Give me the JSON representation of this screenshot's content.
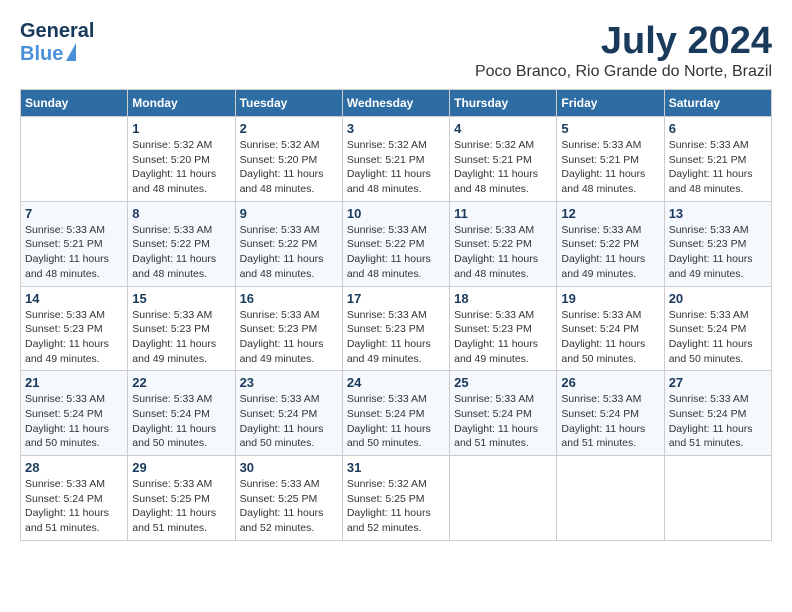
{
  "header": {
    "logo_general": "General",
    "logo_blue": "Blue",
    "month": "July 2024",
    "location": "Poco Branco, Rio Grande do Norte, Brazil"
  },
  "columns": [
    "Sunday",
    "Monday",
    "Tuesday",
    "Wednesday",
    "Thursday",
    "Friday",
    "Saturday"
  ],
  "weeks": [
    [
      {
        "day": "",
        "info": ""
      },
      {
        "day": "1",
        "info": "Sunrise: 5:32 AM\nSunset: 5:20 PM\nDaylight: 11 hours\nand 48 minutes."
      },
      {
        "day": "2",
        "info": "Sunrise: 5:32 AM\nSunset: 5:20 PM\nDaylight: 11 hours\nand 48 minutes."
      },
      {
        "day": "3",
        "info": "Sunrise: 5:32 AM\nSunset: 5:21 PM\nDaylight: 11 hours\nand 48 minutes."
      },
      {
        "day": "4",
        "info": "Sunrise: 5:32 AM\nSunset: 5:21 PM\nDaylight: 11 hours\nand 48 minutes."
      },
      {
        "day": "5",
        "info": "Sunrise: 5:33 AM\nSunset: 5:21 PM\nDaylight: 11 hours\nand 48 minutes."
      },
      {
        "day": "6",
        "info": "Sunrise: 5:33 AM\nSunset: 5:21 PM\nDaylight: 11 hours\nand 48 minutes."
      }
    ],
    [
      {
        "day": "7",
        "info": "Sunrise: 5:33 AM\nSunset: 5:21 PM\nDaylight: 11 hours\nand 48 minutes."
      },
      {
        "day": "8",
        "info": "Sunrise: 5:33 AM\nSunset: 5:22 PM\nDaylight: 11 hours\nand 48 minutes."
      },
      {
        "day": "9",
        "info": "Sunrise: 5:33 AM\nSunset: 5:22 PM\nDaylight: 11 hours\nand 48 minutes."
      },
      {
        "day": "10",
        "info": "Sunrise: 5:33 AM\nSunset: 5:22 PM\nDaylight: 11 hours\nand 48 minutes."
      },
      {
        "day": "11",
        "info": "Sunrise: 5:33 AM\nSunset: 5:22 PM\nDaylight: 11 hours\nand 48 minutes."
      },
      {
        "day": "12",
        "info": "Sunrise: 5:33 AM\nSunset: 5:22 PM\nDaylight: 11 hours\nand 49 minutes."
      },
      {
        "day": "13",
        "info": "Sunrise: 5:33 AM\nSunset: 5:23 PM\nDaylight: 11 hours\nand 49 minutes."
      }
    ],
    [
      {
        "day": "14",
        "info": "Sunrise: 5:33 AM\nSunset: 5:23 PM\nDaylight: 11 hours\nand 49 minutes."
      },
      {
        "day": "15",
        "info": "Sunrise: 5:33 AM\nSunset: 5:23 PM\nDaylight: 11 hours\nand 49 minutes."
      },
      {
        "day": "16",
        "info": "Sunrise: 5:33 AM\nSunset: 5:23 PM\nDaylight: 11 hours\nand 49 minutes."
      },
      {
        "day": "17",
        "info": "Sunrise: 5:33 AM\nSunset: 5:23 PM\nDaylight: 11 hours\nand 49 minutes."
      },
      {
        "day": "18",
        "info": "Sunrise: 5:33 AM\nSunset: 5:23 PM\nDaylight: 11 hours\nand 49 minutes."
      },
      {
        "day": "19",
        "info": "Sunrise: 5:33 AM\nSunset: 5:24 PM\nDaylight: 11 hours\nand 50 minutes."
      },
      {
        "day": "20",
        "info": "Sunrise: 5:33 AM\nSunset: 5:24 PM\nDaylight: 11 hours\nand 50 minutes."
      }
    ],
    [
      {
        "day": "21",
        "info": "Sunrise: 5:33 AM\nSunset: 5:24 PM\nDaylight: 11 hours\nand 50 minutes."
      },
      {
        "day": "22",
        "info": "Sunrise: 5:33 AM\nSunset: 5:24 PM\nDaylight: 11 hours\nand 50 minutes."
      },
      {
        "day": "23",
        "info": "Sunrise: 5:33 AM\nSunset: 5:24 PM\nDaylight: 11 hours\nand 50 minutes."
      },
      {
        "day": "24",
        "info": "Sunrise: 5:33 AM\nSunset: 5:24 PM\nDaylight: 11 hours\nand 50 minutes."
      },
      {
        "day": "25",
        "info": "Sunrise: 5:33 AM\nSunset: 5:24 PM\nDaylight: 11 hours\nand 51 minutes."
      },
      {
        "day": "26",
        "info": "Sunrise: 5:33 AM\nSunset: 5:24 PM\nDaylight: 11 hours\nand 51 minutes."
      },
      {
        "day": "27",
        "info": "Sunrise: 5:33 AM\nSunset: 5:24 PM\nDaylight: 11 hours\nand 51 minutes."
      }
    ],
    [
      {
        "day": "28",
        "info": "Sunrise: 5:33 AM\nSunset: 5:24 PM\nDaylight: 11 hours\nand 51 minutes."
      },
      {
        "day": "29",
        "info": "Sunrise: 5:33 AM\nSunset: 5:25 PM\nDaylight: 11 hours\nand 51 minutes."
      },
      {
        "day": "30",
        "info": "Sunrise: 5:33 AM\nSunset: 5:25 PM\nDaylight: 11 hours\nand 52 minutes."
      },
      {
        "day": "31",
        "info": "Sunrise: 5:32 AM\nSunset: 5:25 PM\nDaylight: 11 hours\nand 52 minutes."
      },
      {
        "day": "",
        "info": ""
      },
      {
        "day": "",
        "info": ""
      },
      {
        "day": "",
        "info": ""
      }
    ]
  ]
}
